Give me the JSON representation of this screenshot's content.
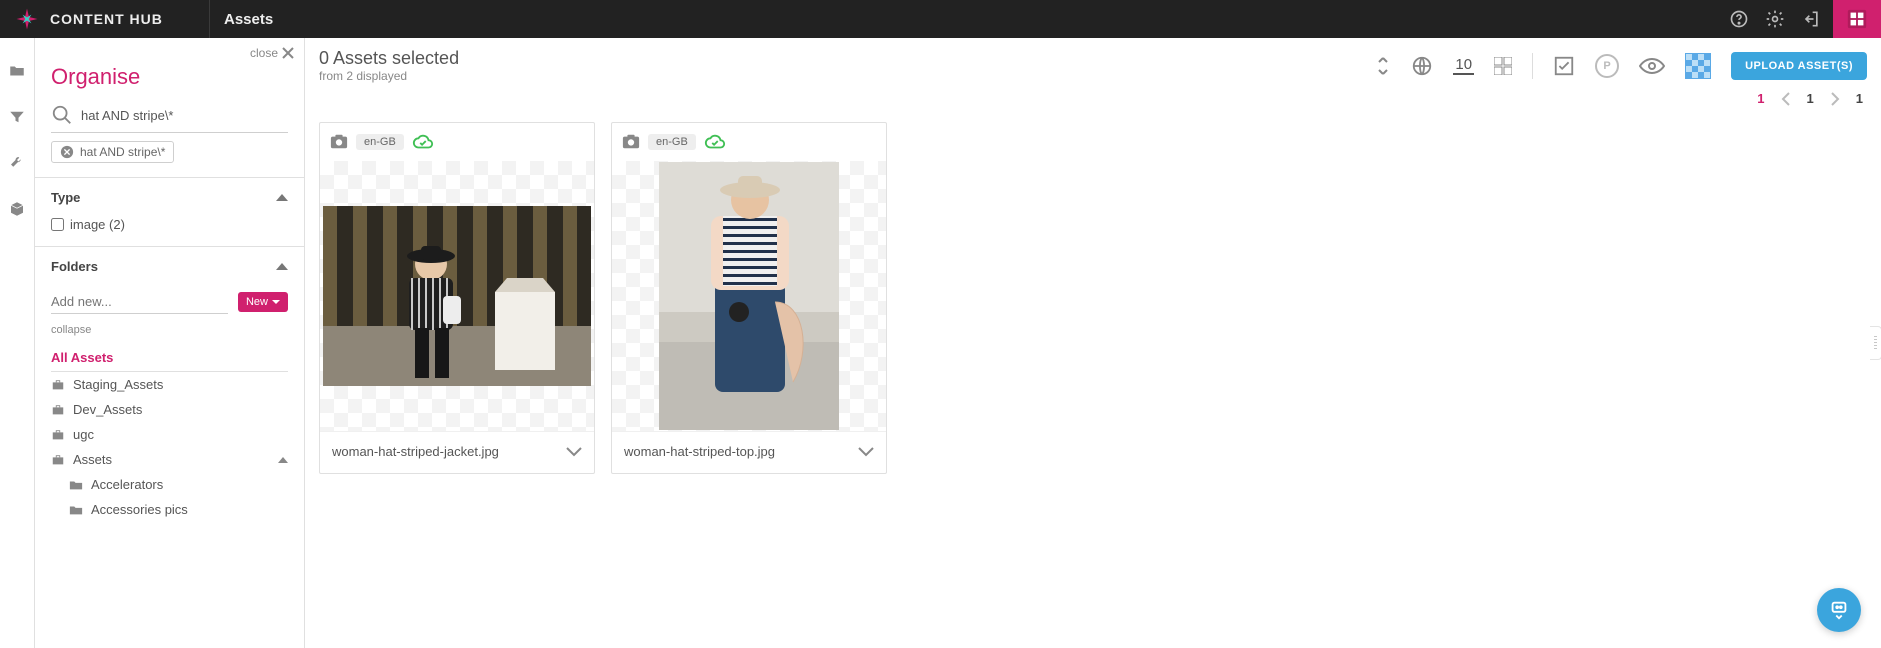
{
  "brand": "CONTENT HUB",
  "page_title": "Assets",
  "sidebar": {
    "close_label": "close",
    "title": "Organise",
    "search_value": "hat AND stripe\\*",
    "chip": "hat AND stripe\\*",
    "type": {
      "title": "Type",
      "option_label": "image (2)"
    },
    "folders": {
      "title": "Folders",
      "add_placeholder": "Add new...",
      "new_btn": "New",
      "collapse": "collapse",
      "all_assets": "All Assets",
      "items": [
        {
          "label": "Staging_Assets",
          "kind": "briefcase"
        },
        {
          "label": "Dev_Assets",
          "kind": "briefcase"
        },
        {
          "label": "ugc",
          "kind": "briefcase"
        },
        {
          "label": "Assets",
          "kind": "briefcase",
          "expandable": true
        },
        {
          "label": "Accelerators",
          "kind": "folder",
          "sub": true
        },
        {
          "label": "Accessories pics",
          "kind": "folder",
          "sub": true
        }
      ]
    }
  },
  "toolbar": {
    "selected_line": "0 Assets selected",
    "from_line": "from 2 displayed",
    "page_size": "10",
    "p_badge": "P",
    "upload_label": "UPLOAD ASSET(S)"
  },
  "pager": {
    "first": "1",
    "current": "1",
    "last": "1"
  },
  "assets": [
    {
      "locale": "en-GB",
      "filename": "woman-hat-striped-jacket.jpg",
      "layout": "landscape"
    },
    {
      "locale": "en-GB",
      "filename": "woman-hat-striped-top.jpg",
      "layout": "portrait"
    }
  ]
}
